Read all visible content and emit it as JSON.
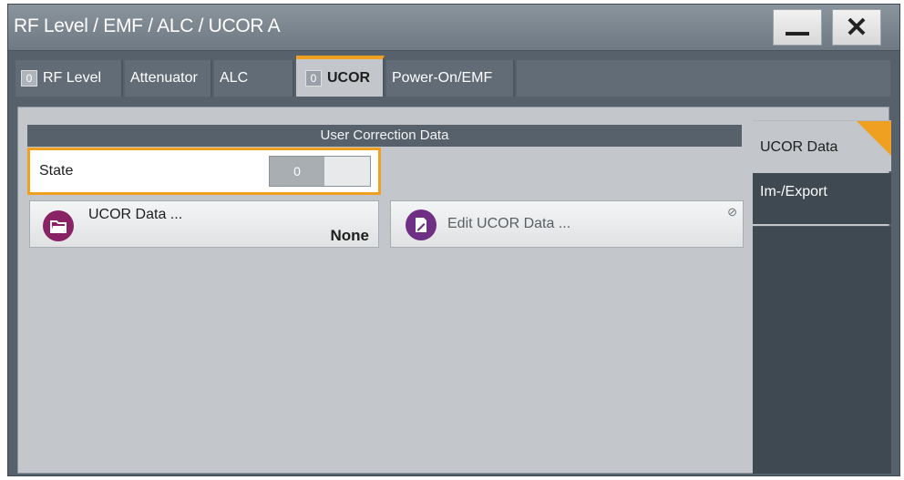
{
  "window": {
    "title": "RF Level / EMF / ALC / UCOR A",
    "minimize_label": "",
    "close_label": "✕"
  },
  "tabs": [
    {
      "label": "RF Level",
      "led": "0"
    },
    {
      "label": "Attenuator"
    },
    {
      "label": "ALC"
    },
    {
      "label": "UCOR",
      "led": "0",
      "active": true
    },
    {
      "label": "Power-On/EMF"
    }
  ],
  "section": {
    "title": "User Correction Data"
  },
  "state": {
    "label": "State",
    "value": "0"
  },
  "ucor_data_button": {
    "label": "UCOR Data ...",
    "value": "None",
    "icon": "folder-icon"
  },
  "edit_button": {
    "label": "Edit UCOR Data ...",
    "icon": "edit-document-icon",
    "disabled_icon": "⊘"
  },
  "side_tabs": [
    {
      "label": "UCOR Data",
      "active": true
    },
    {
      "label": "Im-/Export"
    }
  ],
  "colors": {
    "accent": "#f0a020",
    "header": "#56616c",
    "panel": "#c3c7cb",
    "icon_magenta": "#8a2266"
  }
}
